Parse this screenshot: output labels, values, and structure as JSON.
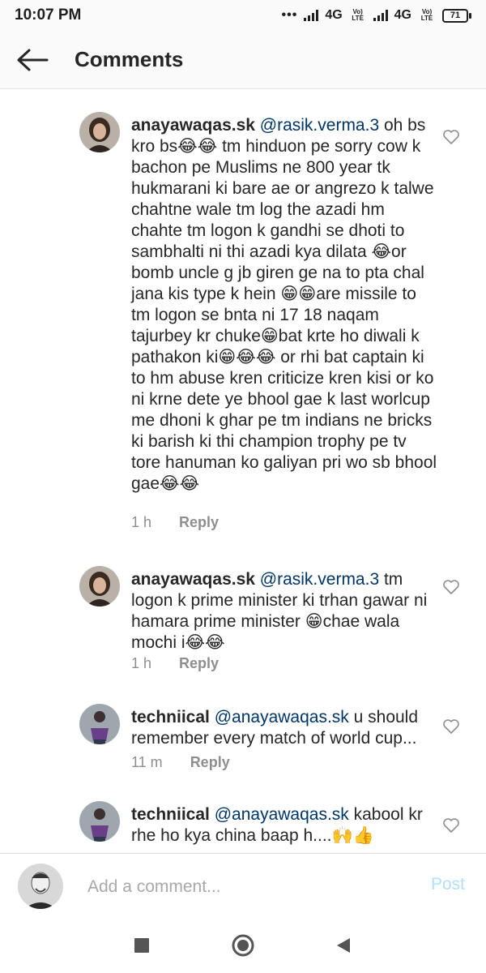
{
  "status_bar": {
    "time": "10:07 PM",
    "dots": "•••",
    "net1": "4G",
    "lte1": "Vo) LTE",
    "net2": "4G",
    "lte2": "Vo) LTE",
    "battery": "71"
  },
  "header": {
    "title": "Comments",
    "back_icon": "arrow-left-icon"
  },
  "comments": [
    {
      "username": "anayawaqas.sk",
      "mention": "@rasik.verma.3",
      "text": " oh bs kro bs😂😂 tm hinduon pe sorry cow k bachon pe Muslims ne 800 year tk hukmarani ki bare ae or angrezo k talwe chahtne wale tm log the azadi hm chahte tm logon k gandhi se dhoti to sambhalti ni thi azadi kya dilata 😂or bomb uncle g jb giren ge na to pta chal jana kis type k hein 😁😁are missile to tm logon se bnta ni 17 18 naqam tajurbey kr chuke😁bat krte ho diwali k pathakon ki😁😂😂 or rhi bat captain ki to hm abuse kren criticize kren kisi or ko ni krne dete ye bhool gae k last worlcup me dhoni k ghar pe tm indians ne bricks ki barish ki thi champion trophy pe tv tore hanuman ko galiyan pri wo sb bhool gae😂😂",
      "time": "1 h",
      "reply": "Reply"
    },
    {
      "username": "anayawaqas.sk",
      "mention": "@rasik.verma.3",
      "text": " tm logon k prime minister  ki trhan gawar ni hamara prime minister 😁chae wala mochi i😂😂",
      "time": "1 h",
      "reply": "Reply"
    },
    {
      "username": "techniical",
      "mention": "@anayawaqas.sk",
      "text": " u should remember every match of world cup...",
      "time": "11 m",
      "reply": "Reply"
    },
    {
      "username": "techniical",
      "mention": "@anayawaqas.sk",
      "text": " kabool kr rhe ho kya china baap h....🙌👍",
      "time": "",
      "reply": ""
    }
  ],
  "composer": {
    "placeholder": "Add a comment...",
    "post_label": "Post"
  },
  "nav": {
    "recent": "square-icon",
    "home": "circle-icon",
    "back": "triangle-back-icon"
  }
}
